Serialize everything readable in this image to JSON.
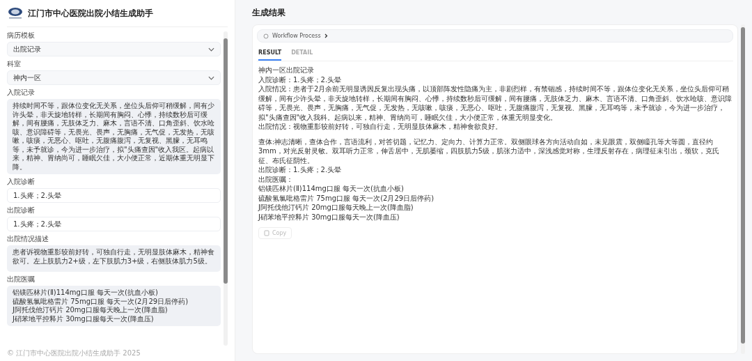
{
  "app": {
    "title": "江门市中心医院出院小结生成助手"
  },
  "form": {
    "fields": [
      {
        "kind": "select",
        "label": "病历模板",
        "lines": [
          "出院记录"
        ]
      },
      {
        "kind": "select",
        "label": "科室",
        "lines": [
          "神内一区"
        ]
      },
      {
        "kind": "textarea",
        "label": "入院记录",
        "lines": [
          "持续时间不等，跟体位变化无关系，坐位头后仰可稍缓解，间有少许头晕，非天旋地转样，长期间有胸闷、心悸，持续数秒后可缓解，间有腰痛，无肢体乏力、麻木，言语不清、口角歪斜、饮水呛咳、意识障碍等，无畏光、畏声，无胸痛，无气促，无发热，无咳嗽，咳痰，无恶心、呕吐，无腹痛腹泻，无复视、黑朦，无耳鸣等，未予就诊，今为进一步治疗，拟\"头痛查因\"收入我区。起病以来，精神、胃纳尚可，睡眠欠佳，大小便正常，近期体重无明显下降。"
        ]
      },
      {
        "kind": "input",
        "label": "入院诊断",
        "lines": [
          "1.头疼；2.头晕"
        ]
      },
      {
        "kind": "input",
        "label": "出院诊断",
        "lines": [
          "1.头疼；2.头晕"
        ]
      },
      {
        "kind": "textarea",
        "label": "出院情况描述",
        "lines": [
          "患者诉视物重影较前好转，可独自行走，无明显肢体麻木，精神食欲可。左上肢肌力2+级，左下肢肌力3+级，右侧肢体肌力5级。"
        ]
      },
      {
        "kind": "textarea",
        "label": "出院医嘱",
        "lines": [
          "铝镁匹林片(Ⅱ)114mg口服 每天一次(抗血小板)",
          "硫酸氢氯吡格雷片 75mg口服 每天一次(2月29日后停药)",
          "J阿托伐他汀钙片 20mg口服每天晚上一次(降血脂)",
          "J硝苯地平控释片 30mg口服每天一次(降血压)"
        ]
      }
    ]
  },
  "footer": "© 江门市中心医院出院小结生成助手 2025",
  "result": {
    "heading": "生成结果",
    "workflow": "Workflow Process",
    "tabs": [
      {
        "label": "RESULT",
        "selected": true
      },
      {
        "label": "DETAIL",
        "selected": false
      }
    ],
    "paragraphs": [
      [
        "神内一区出院记录",
        "入院诊断：1.头疼；2.头晕",
        "入院情况：患者于2月余前无明显诱因反复出现头痛，以顶部阵发性隐痛为主，非剧烈样，有禁锢感，持续时间不等，跟体位变化无关系，坐位头后仰可稍缓解，间有少许头晕，非天旋地转样，长期间有胸闷、心悸，持续数秒后可缓解，间有腰痛，无肢体乏力、麻木、言语不清、口角歪斜、饮水呛咳、意识障碍等，无畏光、畏声，无胸痛，无气促，无发热，无咳嗽，咳痰，无恶心、呕吐，无腹痛腹泻，无复视、黑朦，无耳鸣等，未予就诊，今为进一步治疗，拟\"头痛查因\"收入我科。起病以来，精神、胃纳尚可，睡眠欠佳，大小便正常，体重无明显变化。",
        "出院情况：视物重影较前好转，可独自行走，无明显肢体麻木，精神食欲良好。"
      ],
      [
        "查体:神志清晰，查体合作，言语流利，对答切题，记忆力、定向力、计算力正常。双侧眼球各方向活动自如，未见眼震，双侧瞳孔等大等圆，直径约3mm，对光反射灵敏。双耳听力正常，伸舌居中，无肌萎缩，四肢肌力5级，肌张力适中，深浅感觉对称，生理反射存在，病理征未引出，颈软，克氏征、布氏征阴性。",
        "出院诊断：1.头疼；2.头晕",
        "出院医嘱：",
        "铝镁匹林片(Ⅱ)114mg口服 每天一次(抗血小板)",
        "硫酸氢氯吡格雷片 75mg口服 每天一次(2月29日后停药)",
        "J阿托伐他汀钙片 20mg口服每天晚上一次(降血脂)",
        "J硝苯地平控释片 30mg口服每天一次(降血压)"
      ]
    ],
    "copy_button": "Copy"
  }
}
